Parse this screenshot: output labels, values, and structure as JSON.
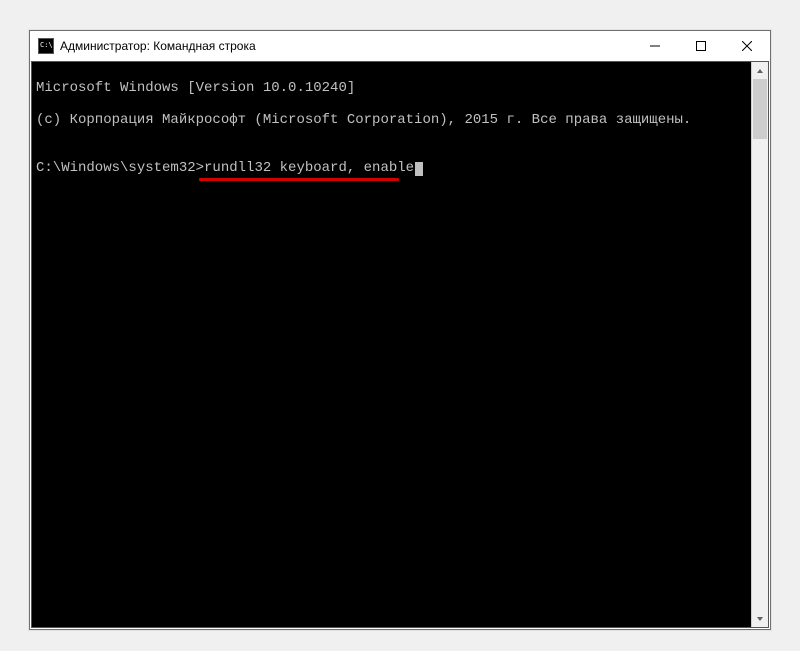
{
  "window": {
    "title": "Администратор: Командная строка"
  },
  "console": {
    "line1": "Microsoft Windows [Version 10.0.10240]",
    "line2": "(c) Корпорация Майкрософт (Microsoft Corporation), 2015 г. Все права защищены.",
    "blank": "",
    "prompt": "C:\\Windows\\system32>",
    "command": "rundll32 keyboard, enable"
  }
}
